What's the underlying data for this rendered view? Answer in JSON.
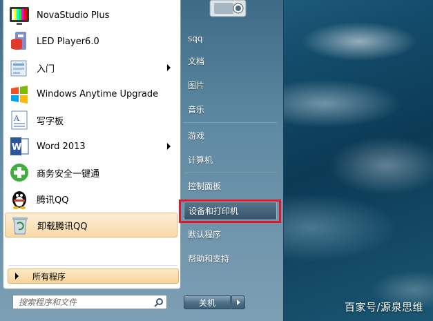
{
  "start_menu": {
    "pinned_programs": [
      {
        "label": "NovaStudio Plus",
        "icon": "tv-color-bars-icon",
        "has_submenu": false
      },
      {
        "label": "LED Player6.0",
        "icon": "led-player-icon",
        "has_submenu": false
      },
      {
        "label": "入门",
        "icon": "getting-started-icon",
        "has_submenu": true
      },
      {
        "label": "Windows Anytime Upgrade",
        "icon": "windows-flag-icon",
        "has_submenu": false
      },
      {
        "label": "写字板",
        "icon": "wordpad-icon",
        "has_submenu": false
      },
      {
        "label": "Word 2013",
        "icon": "word-icon",
        "has_submenu": true
      },
      {
        "label": "商务安全一键通",
        "icon": "green-plus-icon",
        "has_submenu": false
      },
      {
        "label": "腾讯QQ",
        "icon": "qq-penguin-icon",
        "has_submenu": false
      },
      {
        "label": "卸载腾讯QQ",
        "icon": "uninstall-recycle-icon",
        "has_submenu": false,
        "highlighted": true
      }
    ],
    "all_programs_label": "所有程序",
    "search_placeholder": "搜索程序和文件",
    "right_links": [
      {
        "label": "sqq"
      },
      {
        "label": "文档"
      },
      {
        "label": "图片"
      },
      {
        "label": "音乐"
      },
      {
        "label": "游戏"
      },
      {
        "label": "计算机"
      },
      {
        "label": "控制面板"
      },
      {
        "label": "设备和打印机",
        "highlighted": true
      },
      {
        "label": "默认程序"
      },
      {
        "label": "帮助和支持"
      }
    ],
    "shutdown_label": "关机",
    "highlight_color": "#e3192b"
  },
  "watermark": "百家号/源泉思维"
}
